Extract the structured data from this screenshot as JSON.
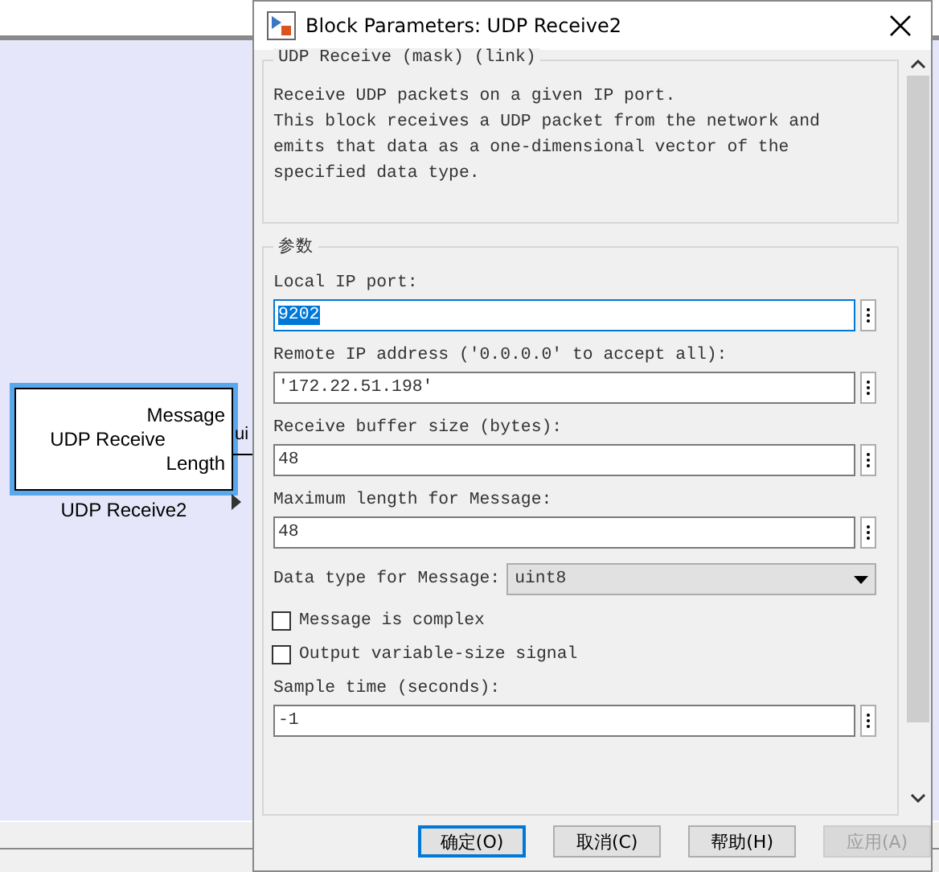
{
  "canvas": {
    "block": {
      "ports": [
        "Message",
        "Length"
      ],
      "name": "UDP Receive",
      "label": "UDP Receive2",
      "selected": true
    },
    "signal_label": "ui"
  },
  "dialog": {
    "title": "Block Parameters: UDP Receive2",
    "description": {
      "title": "UDP Receive (mask) (link)",
      "lines": [
        "Receive UDP packets on a given IP port.",
        "This block receives a UDP packet from the network and",
        "emits that data as a one-dimensional vector of the",
        "specified data type."
      ]
    },
    "params": {
      "title": "参数",
      "items": [
        {
          "kind": "edit",
          "label": "Local IP port:",
          "value": "9202",
          "focused": true
        },
        {
          "kind": "edit",
          "label": "Remote IP address ('0.0.0.0' to accept all):",
          "value": "'172.22.51.198'",
          "focused": false
        },
        {
          "kind": "edit",
          "label": "Receive buffer size (bytes):",
          "value": "48",
          "focused": false
        },
        {
          "kind": "edit",
          "label": "Maximum length for Message:",
          "value": "48",
          "focused": false
        },
        {
          "kind": "popup",
          "label": "Data type for Message:",
          "value": "uint8"
        },
        {
          "kind": "check",
          "label": "Message is complex",
          "checked": false
        },
        {
          "kind": "check",
          "label": "Output variable-size signal",
          "checked": false
        },
        {
          "kind": "edit",
          "label": "Sample time (seconds):",
          "value": "-1",
          "focused": false
        }
      ]
    },
    "buttons": [
      {
        "label": "确定(O)",
        "default": true,
        "disabled": false
      },
      {
        "label": "取消(C)",
        "default": false,
        "disabled": false
      },
      {
        "label": "帮助(H)",
        "default": false,
        "disabled": false
      },
      {
        "label": "应用(A)",
        "default": false,
        "disabled": true
      }
    ]
  }
}
